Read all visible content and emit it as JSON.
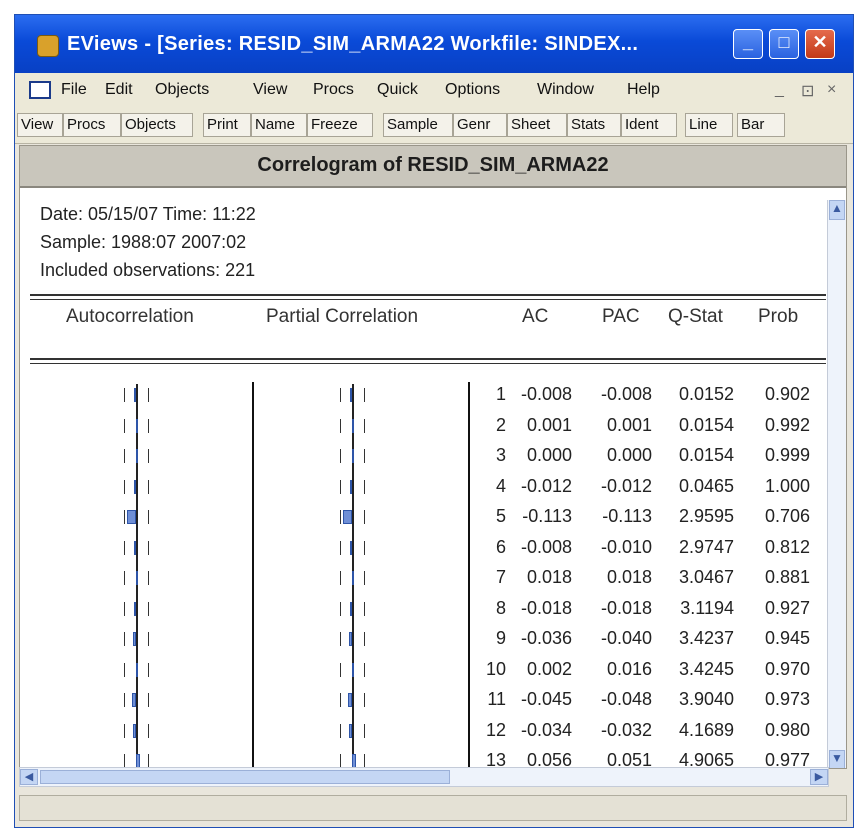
{
  "window": {
    "title": "EViews - [Series: RESID_SIM_ARMA22   Workfile: SINDEX...",
    "minimize_glyph": "_",
    "maximize_glyph": "□",
    "close_glyph": "✕"
  },
  "menu": {
    "items": [
      "File",
      "Edit",
      "Objects",
      "View",
      "Procs",
      "Quick",
      "Options",
      "Window",
      "Help"
    ],
    "child_min": "_",
    "child_restore": "⊡",
    "child_close": "×"
  },
  "toolbar": {
    "buttons": [
      "View",
      "Procs",
      "Objects",
      "Print",
      "Name",
      "Freeze",
      "Sample",
      "Genr",
      "Sheet",
      "Stats",
      "Ident",
      "Line",
      "Bar"
    ]
  },
  "report": {
    "heading": "Correlogram of RESID_SIM_ARMA22",
    "date_line": "Date: 05/15/07   Time: 11:22",
    "sample_line": "Sample: 1988:07 2007:02",
    "obs_line": "Included observations: 221",
    "columns": {
      "autocorrelation": "Autocorrelation",
      "partial": "Partial Correlation",
      "ac": "AC",
      "pac": "PAC",
      "qstat": "Q-Stat",
      "prob": "Prob"
    },
    "rows": [
      {
        "lag": "1",
        "ac": "-0.008",
        "pac": "-0.008",
        "q": "0.0152",
        "p": "0.902"
      },
      {
        "lag": "2",
        "ac": "0.001",
        "pac": "0.001",
        "q": "0.0154",
        "p": "0.992"
      },
      {
        "lag": "3",
        "ac": "0.000",
        "pac": "0.000",
        "q": "0.0154",
        "p": "0.999"
      },
      {
        "lag": "4",
        "ac": "-0.012",
        "pac": "-0.012",
        "q": "0.0465",
        "p": "1.000"
      },
      {
        "lag": "5",
        "ac": "-0.113",
        "pac": "-0.113",
        "q": "2.9595",
        "p": "0.706"
      },
      {
        "lag": "6",
        "ac": "-0.008",
        "pac": "-0.010",
        "q": "2.9747",
        "p": "0.812"
      },
      {
        "lag": "7",
        "ac": "0.018",
        "pac": "0.018",
        "q": "3.0467",
        "p": "0.881"
      },
      {
        "lag": "8",
        "ac": "-0.018",
        "pac": "-0.018",
        "q": "3.1194",
        "p": "0.927"
      },
      {
        "lag": "9",
        "ac": "-0.036",
        "pac": "-0.040",
        "q": "3.4237",
        "p": "0.945"
      },
      {
        "lag": "10",
        "ac": "0.002",
        "pac": "0.016",
        "q": "3.4245",
        "p": "0.970"
      },
      {
        "lag": "11",
        "ac": "-0.045",
        "pac": "-0.048",
        "q": "3.9040",
        "p": "0.973"
      },
      {
        "lag": "12",
        "ac": "-0.034",
        "pac": "-0.032",
        "q": "4.1689",
        "p": "0.980"
      },
      {
        "lag": "13",
        "ac": "0.056",
        "pac": "0.051",
        "q": "4.9065",
        "p": "0.977"
      }
    ]
  }
}
